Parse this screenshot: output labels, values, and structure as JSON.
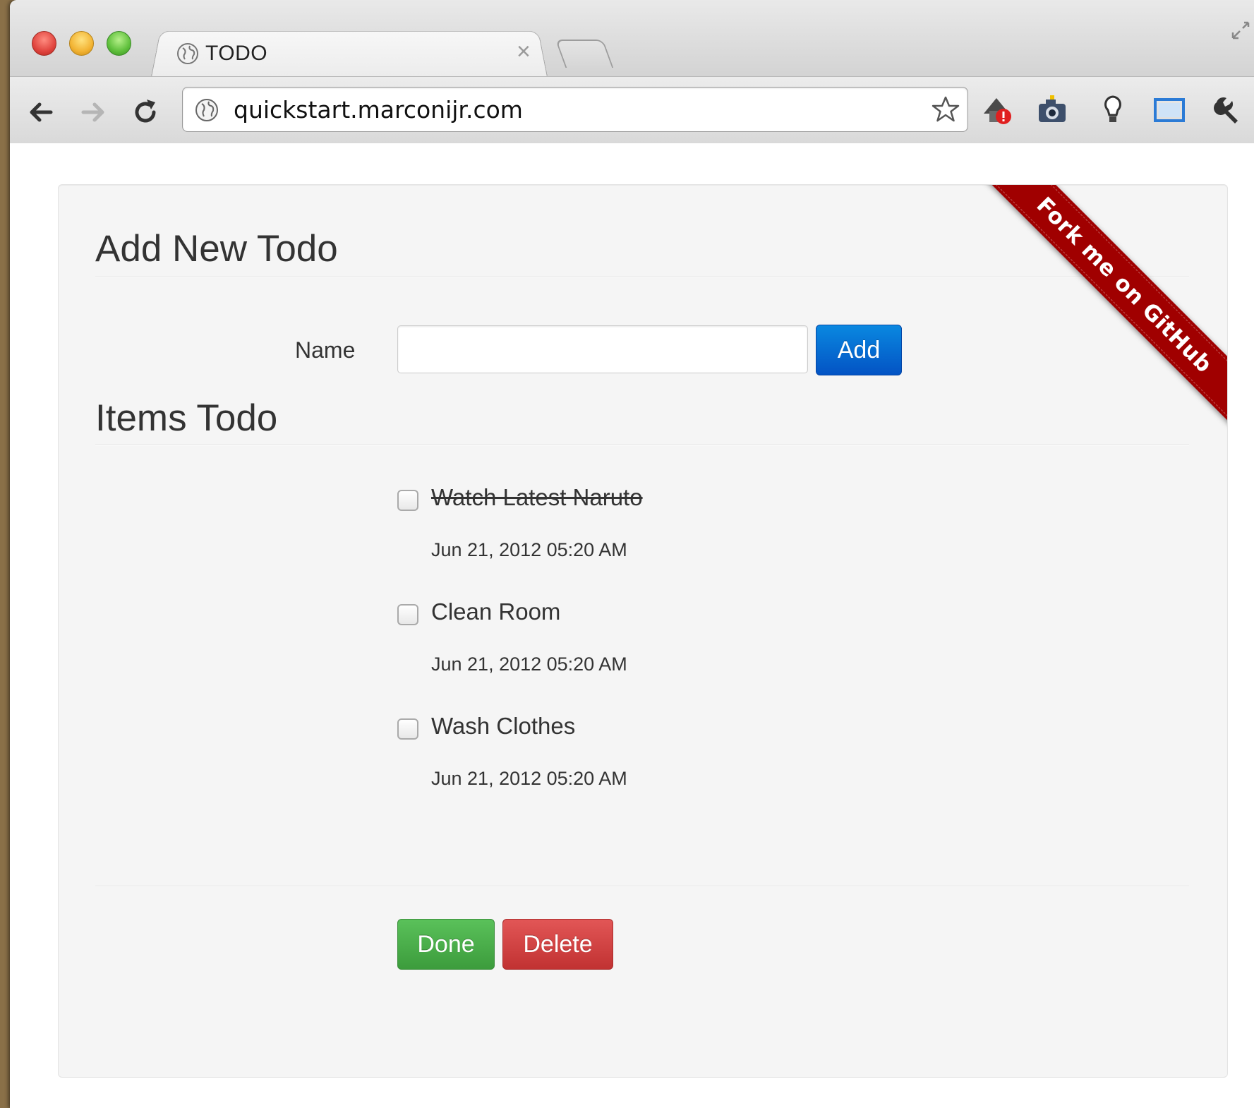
{
  "browser": {
    "tab_title": "TODO",
    "url": "quickstart.marconijr.com"
  },
  "page": {
    "add_heading": "Add New Todo",
    "name_label": "Name",
    "name_input_value": "",
    "add_button": "Add",
    "items_heading": "Items Todo",
    "ribbon": "Fork me on GitHub",
    "done_button": "Done",
    "delete_button": "Delete",
    "todos": [
      {
        "title": "Watch Latest Naruto",
        "date": "Jun 21, 2012 05:20 AM",
        "completed": true
      },
      {
        "title": "Clean Room",
        "date": "Jun 21, 2012 05:20 AM",
        "completed": false
      },
      {
        "title": "Wash Clothes",
        "date": "Jun 21, 2012 05:20 AM",
        "completed": false
      }
    ]
  },
  "colors": {
    "primary": "#0353c4",
    "success": "#3c9c3c",
    "danger": "#c13232",
    "ribbon": "#a00000"
  },
  "icons": [
    "globe-icon",
    "close-icon",
    "back-icon",
    "forward-icon",
    "reload-icon",
    "star-icon",
    "wrench-icon"
  ]
}
